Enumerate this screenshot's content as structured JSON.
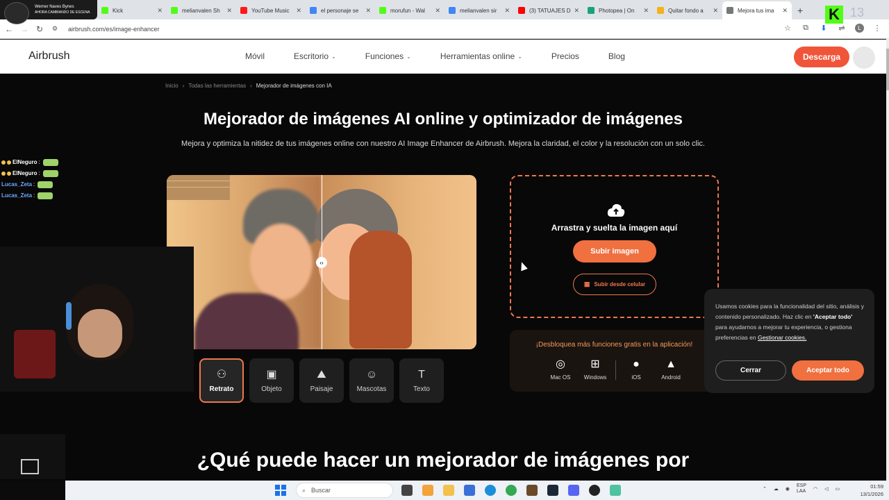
{
  "stream": {
    "top_label_1": "Werner Naves Bynes",
    "top_label_2": "AHORA CAMBIANDO DE ESCENA"
  },
  "tabs": [
    {
      "label": "Kick",
      "color": "#53fc18"
    },
    {
      "label": "melianvalen Sh",
      "color": "#53fc18"
    },
    {
      "label": "YouTube Music",
      "color": "#ff1a1a"
    },
    {
      "label": "el personaje se",
      "color": "#4285f4"
    },
    {
      "label": "morufun - Wal",
      "color": "#53fc18"
    },
    {
      "label": "melianvalen sir",
      "color": "#4285f4"
    },
    {
      "label": "(3) TATUAJES D",
      "color": "#ff0000"
    },
    {
      "label": "Photopea | On",
      "color": "#1aa37a"
    },
    {
      "label": "Quitar fondo a",
      "color": "#f2b21c"
    },
    {
      "label": "Mejora tus ima",
      "color": "#777777"
    }
  ],
  "browser": {
    "url": "airbrush.com/es/image-enhancer",
    "profile_initial": "L"
  },
  "site": {
    "logo": "Airbrush",
    "nav": [
      {
        "label": "Móvil",
        "dropdown": false
      },
      {
        "label": "Escritorio",
        "dropdown": true
      },
      {
        "label": "Funciones",
        "dropdown": true
      },
      {
        "label": "Herramientas online",
        "dropdown": true
      },
      {
        "label": "Precios",
        "dropdown": false
      },
      {
        "label": "Blog",
        "dropdown": false
      }
    ],
    "download": "Descarga",
    "accent": "#f0553a"
  },
  "breadcrumb": [
    "Inicio",
    "Todas las herramientas",
    "Mejorador de imágenes con IA"
  ],
  "hero": {
    "title": "Mejorador de imágenes AI online y optimizador de imágenes",
    "subtitle": "Mejora y optimiza la nitidez de tus imágenes online con nuestro AI Image Enhancer de Airbrush. Mejora la claridad, el color y la resolución con un solo clic."
  },
  "modes": [
    {
      "label": "Retrato",
      "icon": "portrait-icon",
      "glyph": "⚇",
      "active": true
    },
    {
      "label": "Objeto",
      "icon": "object-icon",
      "glyph": "▣",
      "active": false
    },
    {
      "label": "Paisaje",
      "icon": "landscape-icon",
      "glyph": "⛰",
      "active": false
    },
    {
      "label": "Mascotas",
      "icon": "pet-icon",
      "glyph": "☺",
      "active": false
    },
    {
      "label": "Texto",
      "icon": "text-icon",
      "glyph": "T",
      "active": false
    }
  ],
  "upload": {
    "drop_text": "Arrastra y suelta la imagen aquí",
    "button": "Subir imagen",
    "mobile_button": "Subir desde celular"
  },
  "apps": {
    "title": "¡Desbloquea más funciones gratis en la aplicación!",
    "items": [
      {
        "label": "Mac OS",
        "glyph": "◎"
      },
      {
        "label": "Windows",
        "glyph": "⊞"
      },
      {
        "label": "iOS",
        "glyph": "●"
      },
      {
        "label": "Android",
        "glyph": "▲"
      }
    ]
  },
  "section2": {
    "title": "¿Qué puede hacer un mejorador de imágenes por"
  },
  "cookie": {
    "text_a": "Usamos cookies para la funcionalidad del sitio, análisis y contenido personalizado. Haz clic en ",
    "text_bold": "'Aceptar todo'",
    "text_b": " para ayudarnos a mejorar tu experiencia, o gestiona preferencias en ",
    "link": "Gestionar cookies.",
    "close": "Cerrar",
    "accept": "Aceptar todo"
  },
  "chat": [
    {
      "user": "ElNeguro",
      "sep": " :",
      "color": "#ffffff",
      "badges": true
    },
    {
      "user": "ElNeguro",
      "sep": " :",
      "color": "#ffffff",
      "badges": true
    },
    {
      "user": "Lucas_Zeta",
      "sep": " :",
      "color": "#6fa8ff",
      "badges": false
    },
    {
      "user": "Lucas_Zeta",
      "sep": " :",
      "color": "#6fa8ff",
      "badges": false
    }
  ],
  "overlay": {
    "k_num": "13"
  },
  "taskbar": {
    "search": "Buscar",
    "lang_1": "ESP",
    "lang_2": "LAA",
    "time": "01:59",
    "date": "13/1/2026"
  }
}
